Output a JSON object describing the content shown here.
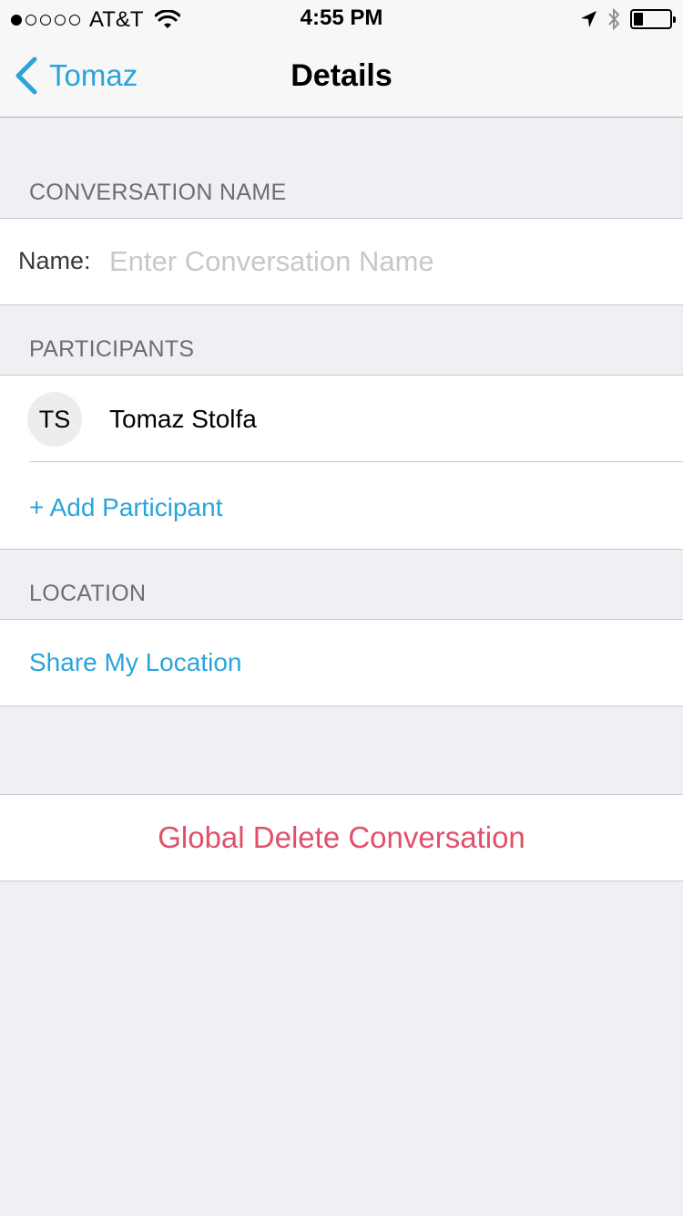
{
  "status_bar": {
    "carrier": "AT&T",
    "time": "4:55 PM",
    "signal_bars_filled": 1,
    "signal_bars_total": 5,
    "battery_level": 0.25
  },
  "nav": {
    "back_label": "Tomaz",
    "title": "Details"
  },
  "conversation_name": {
    "header": "CONVERSATION NAME",
    "label": "Name:",
    "value": "",
    "placeholder": "Enter Conversation Name"
  },
  "participants": {
    "header": "PARTICIPANTS",
    "items": [
      {
        "initials": "TS",
        "name": "Tomaz Stolfa"
      }
    ],
    "add_label": "+ Add Participant"
  },
  "location": {
    "header": "LOCATION",
    "share_label": "Share My Location"
  },
  "actions": {
    "delete_label": "Global Delete Conversation"
  },
  "colors": {
    "accent": "#2ba4d9",
    "destructive": "#e0506a",
    "background": "#efeff4"
  }
}
